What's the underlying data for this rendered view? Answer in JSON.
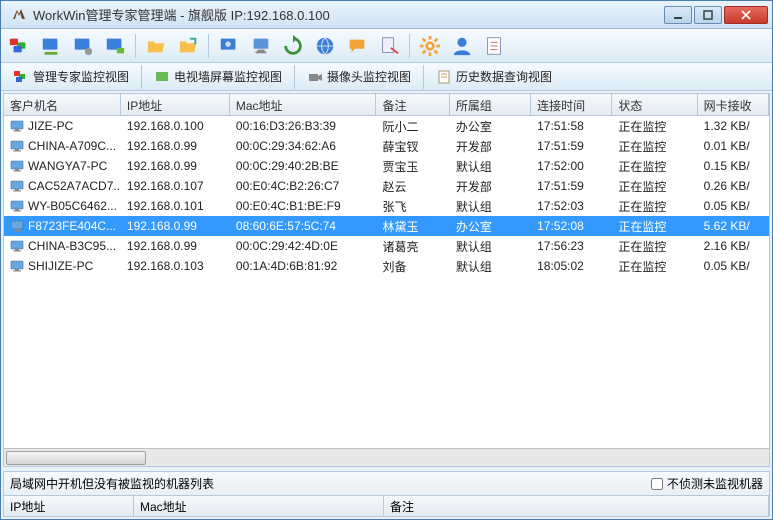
{
  "titlebar": {
    "text": "WorkWin管理专家管理端 - 旗舰版 IP:192.168.0.100"
  },
  "tabs": {
    "t0": "管理专家监控视图",
    "t1": "电视墙屏幕监控视图",
    "t2": "摄像头监控视图",
    "t3": "历史数据查询视图"
  },
  "columns": {
    "c0": "客户机名",
    "c1": "IP地址",
    "c2": "Mac地址",
    "c3": "备注",
    "c4": "所属组",
    "c5": "连接时间",
    "c6": "状态",
    "c7": "网卡接收"
  },
  "rows": [
    {
      "name": "JIZE-PC",
      "ip": "192.168.0.100",
      "mac": "00:16:D3:26:B3:39",
      "note": "阮小二",
      "group": "办公室",
      "time": "17:51:58",
      "status": "正在监控",
      "net": "1.32 KB/",
      "sel": false
    },
    {
      "name": "CHINA-A709C...",
      "ip": "192.168.0.99",
      "mac": "00:0C:29:34:62:A6",
      "note": "薛宝钗",
      "group": "开发部",
      "time": "17:51:59",
      "status": "正在监控",
      "net": "0.01 KB/",
      "sel": false
    },
    {
      "name": "WANGYA7-PC",
      "ip": "192.168.0.99",
      "mac": "00:0C:29:40:2B:BE",
      "note": "贾宝玉",
      "group": "默认组",
      "time": "17:52:00",
      "status": "正在监控",
      "net": "0.15 KB/",
      "sel": false
    },
    {
      "name": "CAC52A7ACD7...",
      "ip": "192.168.0.107",
      "mac": "00:E0:4C:B2:26:C7",
      "note": "赵云",
      "group": "开发部",
      "time": "17:51:59",
      "status": "正在监控",
      "net": "0.26 KB/",
      "sel": false
    },
    {
      "name": "WY-B05C6462...",
      "ip": "192.168.0.101",
      "mac": "00:E0:4C:B1:BE:F9",
      "note": "张飞",
      "group": "默认组",
      "time": "17:52:03",
      "status": "正在监控",
      "net": "0.05 KB/",
      "sel": false
    },
    {
      "name": "F8723FE404C...",
      "ip": "192.168.0.99",
      "mac": "08:60:6E:57:5C:74",
      "note": "林黛玉",
      "group": "办公室",
      "time": "17:52:08",
      "status": "正在监控",
      "net": "5.62 KB/",
      "sel": true
    },
    {
      "name": "CHINA-B3C95...",
      "ip": "192.168.0.99",
      "mac": "00:0C:29:42:4D:0E",
      "note": "诸葛亮",
      "group": "默认组",
      "time": "17:56:23",
      "status": "正在监控",
      "net": "2.16 KB/",
      "sel": false
    },
    {
      "name": "SHIJIZE-PC",
      "ip": "192.168.0.103",
      "mac": "00:1A:4D:6B:81:92",
      "note": "刘备",
      "group": "默认组",
      "time": "18:05:02",
      "status": "正在监控",
      "net": "0.05 KB/",
      "sel": false
    }
  ],
  "bottom": {
    "title": "局域网中开机但没有被监视的机器列表",
    "checkbox": "不侦测未监视机器",
    "cols": {
      "c0": "IP地址",
      "c1": "Mac地址",
      "c2": "备注"
    }
  }
}
